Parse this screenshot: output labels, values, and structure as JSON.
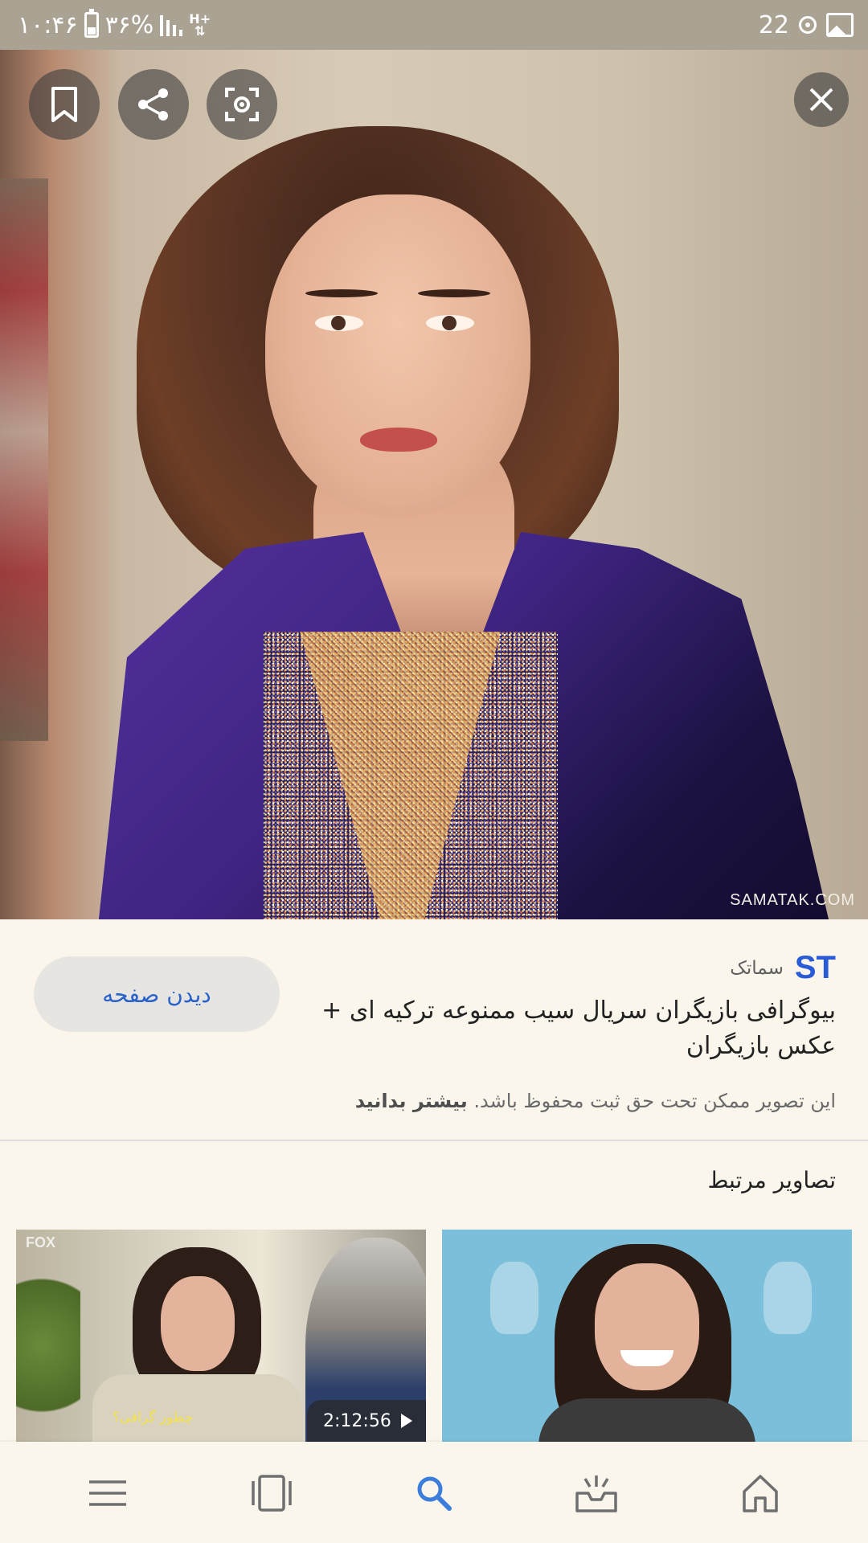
{
  "status_bar": {
    "time": "۱۰:۴۶",
    "battery": "۳۶%",
    "network_top": "H+",
    "network_bottom": "⇅",
    "notification_count": "22"
  },
  "hero": {
    "watermark": "SAMATAK.COM",
    "icons": {
      "bookmark": "bookmark-icon",
      "share": "share-icon",
      "lens": "lens-icon",
      "close": "close-icon"
    }
  },
  "info": {
    "source_logo": "ST",
    "source_name": "سماتک",
    "title": "بیوگرافی بازیگران سریال سیب ممنوعه ترکیه ای + عکس بازیگران",
    "copyright_text": "این تصویر ممکن تحت حق ثبت محفوظ باشد.",
    "learn_more": "بیشتر بدانید",
    "visit_button": "دیدن صفحه"
  },
  "related": {
    "title": "تصاویر مرتبط",
    "items": [
      {
        "badge": "FOX",
        "subtitle": "چطور گرافی؟",
        "duration": "2:12:56"
      },
      {
        "badge": "",
        "subtitle": "",
        "duration": ""
      }
    ]
  },
  "bottom_nav": {
    "items": [
      "menu-icon",
      "collections-icon",
      "search-icon",
      "inbox-icon",
      "home-icon"
    ],
    "active": "search-icon",
    "active_color": "#3d7ddb",
    "inactive_color": "#6f6f6f"
  }
}
